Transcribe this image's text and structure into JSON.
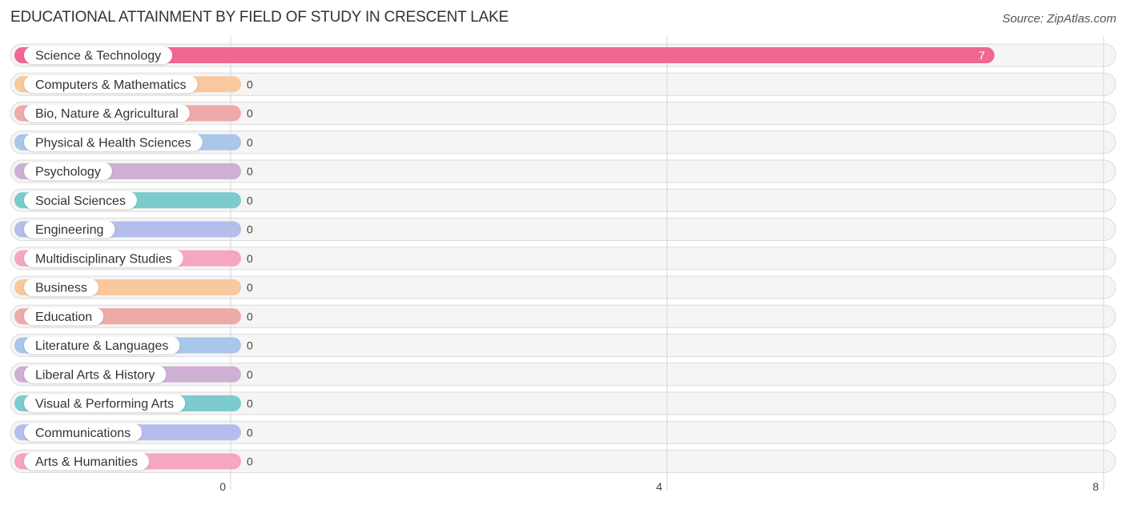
{
  "title": "EDUCATIONAL ATTAINMENT BY FIELD OF STUDY IN CRESCENT LAKE",
  "source": "Source: ZipAtlas.com",
  "chart_data": {
    "type": "bar",
    "orientation": "horizontal",
    "title": "EDUCATIONAL ATTAINMENT BY FIELD OF STUDY IN CRESCENT LAKE",
    "xlabel": "",
    "ylabel": "",
    "xlim": [
      0,
      8
    ],
    "xticks": [
      "0",
      "4",
      "8"
    ],
    "grid": true,
    "categories": [
      "Science & Technology",
      "Computers & Mathematics",
      "Bio, Nature & Agricultural",
      "Physical & Health Sciences",
      "Psychology",
      "Social Sciences",
      "Engineering",
      "Multidisciplinary Studies",
      "Business",
      "Education",
      "Literature & Languages",
      "Liberal Arts & History",
      "Visual & Performing Arts",
      "Communications",
      "Arts & Humanities"
    ],
    "values": [
      7,
      0,
      0,
      0,
      0,
      0,
      0,
      0,
      0,
      0,
      0,
      0,
      0,
      0,
      0
    ],
    "value_labels": [
      "7",
      "0",
      "0",
      "0",
      "0",
      "0",
      "0",
      "0",
      "0",
      "0",
      "0",
      "0",
      "0",
      "0",
      "0"
    ],
    "colors": [
      "#f06792",
      "#f9c89e",
      "#eeaaa8",
      "#a9c6eb",
      "#cdb0d3",
      "#7ccbcd",
      "#b5bdec",
      "#f5a6c1",
      "#f9c89e",
      "#eeaaa8",
      "#a9c6eb",
      "#cdb0d3",
      "#7ccbcd",
      "#b5bdec",
      "#f5a6c1"
    ]
  }
}
